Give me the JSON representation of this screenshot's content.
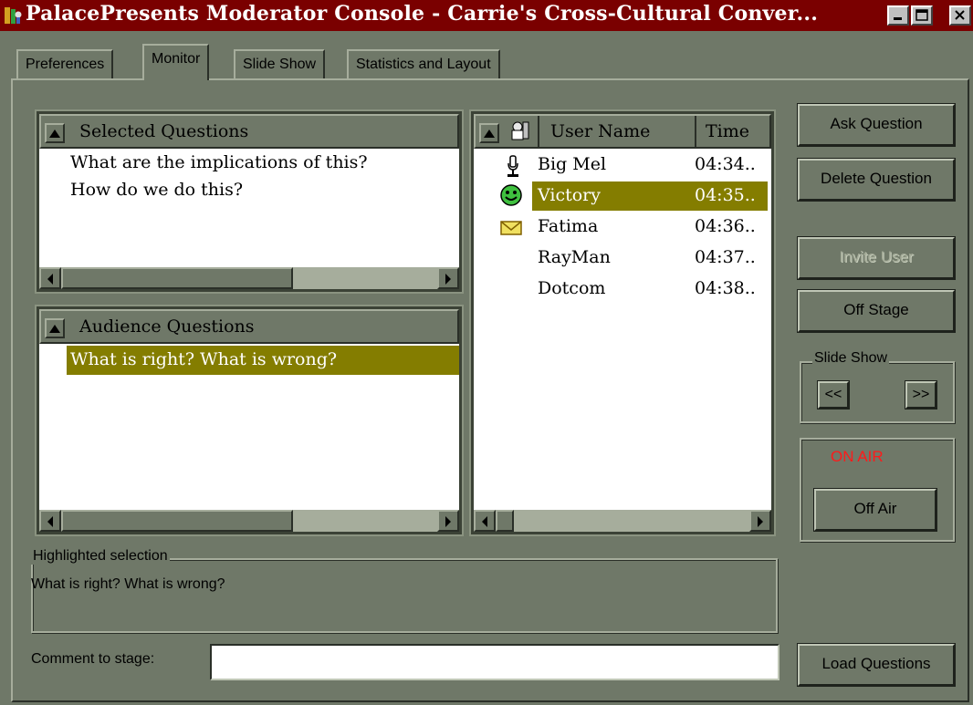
{
  "window": {
    "title": "PalacePresents Moderator Console - Carrie's Cross-Cultural Conver...",
    "controls": [
      "minimize",
      "maximize",
      "close"
    ]
  },
  "tabs": [
    {
      "label": "Preferences",
      "active": false
    },
    {
      "label": "Monitor",
      "active": true
    },
    {
      "label": "Slide Show",
      "active": false
    },
    {
      "label": "Statistics and Layout",
      "active": false
    }
  ],
  "selected_questions": {
    "header": "Selected Questions",
    "items": [
      "What are the implications of this?",
      "How do we do this?"
    ]
  },
  "audience_questions": {
    "header": "Audience Questions",
    "items": [
      "What is right? What is wrong?"
    ],
    "selected_index": 0
  },
  "users": {
    "columns": [
      "User Name",
      "Time"
    ],
    "rows": [
      {
        "name": "Big Mel",
        "time": "04:34..",
        "icon": "microphone-icon"
      },
      {
        "name": "Victory",
        "time": "04:35..",
        "icon": "smiley-icon"
      },
      {
        "name": "Fatima",
        "time": "04:36..",
        "icon": "envelope-icon"
      },
      {
        "name": "RayMan",
        "time": "04:37..",
        "icon": ""
      },
      {
        "name": "Dotcom",
        "time": "04:38..",
        "icon": ""
      }
    ],
    "selected_index": 1
  },
  "buttons": {
    "ask_question": "Ask Question",
    "delete_question": "Delete Question",
    "invite_user": "Invite User",
    "off_stage": "Off Stage",
    "off_air": "Off Air",
    "load_questions": "Load Questions"
  },
  "slide_show": {
    "label": "Slide Show",
    "prev": "<<",
    "next": ">>"
  },
  "on_air": {
    "status": "ON AIR",
    "color": "#ff1a1a"
  },
  "highlighted": {
    "label": "Highlighted selection",
    "text": "What is right? What is wrong?"
  },
  "comment": {
    "label": "Comment to stage:",
    "value": ""
  },
  "colors": {
    "title_bar": "#7a0000",
    "background": "#6f7868",
    "selection": "#847d00"
  }
}
